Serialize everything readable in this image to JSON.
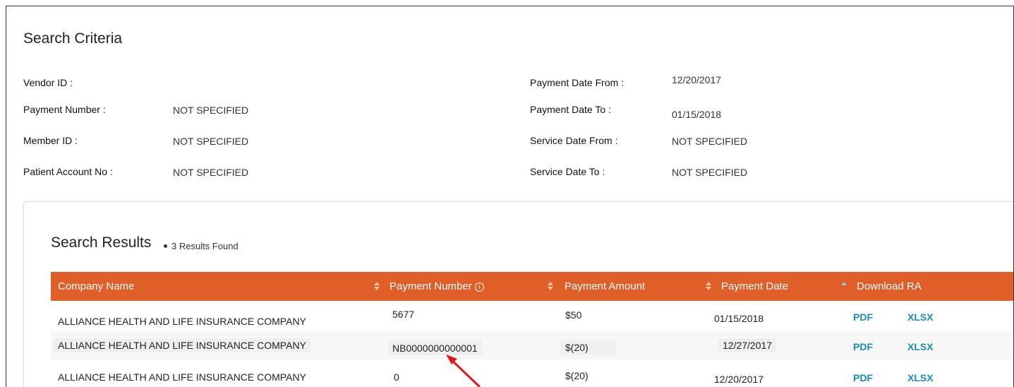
{
  "criteria": {
    "title": "Search Criteria",
    "vendor_id": {
      "label": "Vendor ID :",
      "value": ""
    },
    "payment_number": {
      "label": "Payment Number :",
      "value": "NOT SPECIFIED"
    },
    "member_id": {
      "label": "Member ID :",
      "value": "NOT SPECIFIED"
    },
    "patient_account": {
      "label": "Patient Account No :",
      "value": "NOT SPECIFIED"
    },
    "payment_date_from": {
      "label": "Payment Date From :",
      "value": "12/20/2017"
    },
    "payment_date_to": {
      "label": "Payment Date To :",
      "value": "01/15/2018"
    },
    "service_date_from": {
      "label": "Service Date From :",
      "value": "NOT SPECIFIED"
    },
    "service_date_to": {
      "label": "Service Date To :",
      "value": "NOT SPECIFIED"
    }
  },
  "results": {
    "title": "Search Results",
    "count_text": "3 Results Found",
    "columns": [
      "Company Name",
      "Payment Number",
      "Payment Amount",
      "Payment Date",
      "Download RA"
    ],
    "info_glyph": "i",
    "rows": [
      {
        "company": "ALLIANCE HEALTH AND LIFE INSURANCE COMPANY",
        "payment_number": "5677",
        "amount": "$50",
        "date": "01/15/2018",
        "pdf": "PDF",
        "xlsx": "XLSX"
      },
      {
        "company": "ALLIANCE HEALTH AND LIFE INSURANCE COMPANY",
        "payment_number": "NB0000000000001",
        "amount": "$(20)",
        "date": "12/27/2017",
        "pdf": "PDF",
        "xlsx": "XLSX"
      },
      {
        "company": "ALLIANCE HEALTH AND LIFE INSURANCE COMPANY",
        "payment_number": "0",
        "amount": "$(20)",
        "date": "12/20/2017",
        "pdf": "PDF",
        "xlsx": "XLSX"
      }
    ]
  },
  "colors": {
    "header": "#e05e28",
    "link": "#1a8bb5",
    "annotation_arrow": "#e3161e"
  }
}
